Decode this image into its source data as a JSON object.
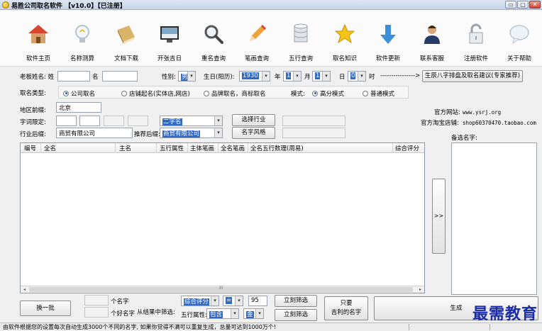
{
  "window": {
    "title": "易胜公司取名软件 【v10.0】【已注册】",
    "controls": [
      "▭",
      "▢",
      "✕"
    ]
  },
  "toolbar": {
    "items": [
      {
        "label": "软件主页",
        "icon": "home-icon"
      },
      {
        "label": "名称测算",
        "icon": "lightbulb-icon"
      },
      {
        "label": "文档下载",
        "icon": "book-icon"
      },
      {
        "label": "开张吉日",
        "icon": "monitor-icon"
      },
      {
        "label": "重名查询",
        "icon": "magnifier-icon"
      },
      {
        "label": "笔画查询",
        "icon": "pencil-icon"
      },
      {
        "label": "五行查询",
        "icon": "database-icon"
      },
      {
        "label": "取名知识",
        "icon": "star-icon"
      },
      {
        "label": "软件更新",
        "icon": "download-arrow-icon"
      },
      {
        "label": "联系客服",
        "icon": "person-icon"
      },
      {
        "label": "注册软件",
        "icon": "padlock-icon"
      },
      {
        "label": "关于帮助",
        "icon": "speech-bubble-icon"
      }
    ]
  },
  "boss": {
    "label": "老板姓名: 姓",
    "surname_value": "",
    "name_label": "名",
    "name_value": "",
    "gender_label": "性别:",
    "gender_value": "男",
    "birthday_label": "生日(阳历):",
    "year_value": "1930",
    "year_unit": "年",
    "month_value": "1",
    "month_unit": "月",
    "day_value": "1",
    "day_unit": "日",
    "hour_value": "0",
    "hour_unit": "时",
    "arrow_text": "---------------->",
    "bazi_button": "生辰八字排盘及取名建议(专家推荐)"
  },
  "naming_type": {
    "label": "取名类型:",
    "options": [
      "公司取名",
      "店铺起名(实体店,网店)",
      "品牌取名，商标取名"
    ],
    "selected": "公司取名",
    "mode_label": "模式:",
    "mode_options": [
      "高分模式",
      "普通模式"
    ],
    "mode_selected": "高分模式"
  },
  "region": {
    "label": "地区前缀:",
    "value": "北京"
  },
  "word_limit": {
    "label": "字词限定:",
    "combo_value": "二字名",
    "industry_button": "选择行业"
  },
  "suffix": {
    "label": "行业后缀:",
    "value": "商贸有限公司",
    "recommend_label": "推荐后缀:",
    "recommend_value": "商贸有限公司",
    "style_button": "名字风格"
  },
  "official": {
    "site_label": "官方网站:",
    "site_value": "www.ysrj.org",
    "shop_label": "官方淘宝店铺:",
    "shop_value": "shop60370470.taobao.com"
  },
  "candidates_label": "备选名字:",
  "transfer_button": ">>",
  "table": {
    "columns": [
      "编号",
      "全名",
      "主名",
      "五行属性",
      "主体笔画",
      "全名笔画",
      "全名五行数理(周易)",
      "综合评分"
    ]
  },
  "scroll_label": "III",
  "bottom": {
    "switch_button": "换一批",
    "count_label_1": "个名字",
    "count_label_2": "个好名字",
    "filter_label": "从结果中筛选:",
    "score_combo": "综合评分",
    "op_combo": "=",
    "score_value": "95",
    "instant_filter_1": "立刻筛选",
    "wuxing_label": "五行属性:",
    "wuxing_combo": "包含",
    "wuxing_value": "金",
    "instant_filter_2": "立刻筛选",
    "lucky_button": "只要\n吉利的名字",
    "generate_button": "生成"
  },
  "watermark": "最需教育",
  "status_text": "由软件根据您的设置每次自动生成3000个不同的名字, 如果你觉得不满可以重复生成，总量可达到1000万个!"
}
